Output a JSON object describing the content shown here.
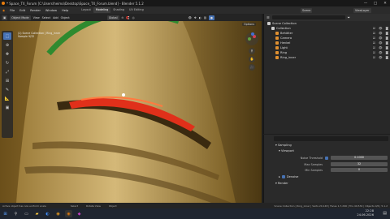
{
  "window": {
    "title": "* Space_TX_Forum [C:\\Users\\heimo\\Desktop\\Space_TX_Forum.blend] - Blender 5.1.2",
    "controls": [
      "—",
      "□",
      "✕"
    ]
  },
  "menubar": {
    "menus": [
      "File",
      "Edit",
      "Render",
      "Window",
      "Help"
    ],
    "workspaces": [
      "Layout",
      "Modeling",
      "Shading",
      "UV Editing"
    ],
    "active_workspace": "Modeling",
    "scene_label": "Scene",
    "viewlayer_label": "ViewLayer"
  },
  "viewport_header": {
    "mode": "Object Mode",
    "menus": [
      "View",
      "Select",
      "Add",
      "Object"
    ],
    "transform": "Global",
    "options": "Options"
  },
  "viewport": {
    "info_line1": "(1) Scene Collection | Ring_inner",
    "info_line2": "Sample 9/32",
    "colors": {
      "base": "#8a6e2e",
      "rim_green": "#2f8a2f",
      "red_glow": "#e0301a"
    }
  },
  "toolbar": {
    "tools": [
      "cursor-icon",
      "move-icon",
      "rotate-icon",
      "scale-icon",
      "transform-icon",
      "annotate-icon",
      "measure-icon",
      "add-cube-icon"
    ]
  },
  "outliner": {
    "header": "Scene Collection",
    "items": [
      {
        "label": "Collection",
        "indent": 1,
        "color": "#cccccc"
      },
      {
        "label": "Behälter",
        "indent": 2,
        "color": "#e09030"
      },
      {
        "label": "Camera",
        "indent": 2,
        "color": "#e09030"
      },
      {
        "label": "Henkel",
        "indent": 2,
        "color": "#e09030"
      },
      {
        "label": "Light",
        "indent": 2,
        "color": "#e09030"
      },
      {
        "label": "Ring",
        "indent": 2,
        "color": "#e09030"
      },
      {
        "label": "Ring_inner",
        "indent": 2,
        "color": "#e09030"
      }
    ]
  },
  "properties": {
    "section_sampling": "Sampling",
    "section_viewport": "Viewport",
    "noise_threshold_label": "Noise Threshold",
    "noise_threshold_value": "0.1000",
    "max_samples_label": "Max Samples",
    "max_samples_value": "32",
    "min_samples_label": "Min Samples",
    "min_samples_value": "0",
    "denoise_label": "Denoise",
    "section_render": "Render"
  },
  "status": {
    "left": "Active object has non-uniform scale",
    "items": [
      "Select",
      "Rotate View",
      "Object"
    ],
    "right": "Scene Collection | Ring_inner | Verts 20,148 | Faces 1,7,296 | Tris 40,532 | Objects 0/6 | 5.1.2"
  },
  "taskbar": {
    "time": "22:28",
    "date": "24.06.2026"
  }
}
